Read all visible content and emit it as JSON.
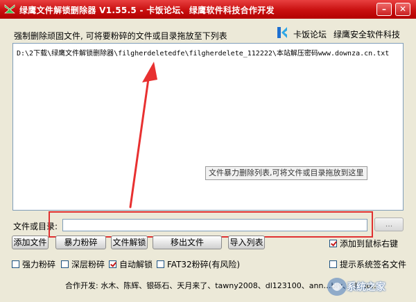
{
  "window": {
    "title": "绿鹰文件解锁删除器 V1.55.5 - 卡饭论坛、绿鹰软件科技合作开发",
    "minimize": "–",
    "close": "✕"
  },
  "header": {
    "description": "强制删除顽固文件, 可将要粉碎的文件或目录拖放至下列表",
    "brand1": "卡饭论坛",
    "brand2": "绿鹰安全软件科技"
  },
  "file_list": {
    "items": [
      "D:\\2下载\\绿鹰文件解锁删除器\\filgherdeletedfe\\filgherdelete_112222\\本站解压密码www.downza.cn.txt"
    ],
    "tooltip": "文件暴力删除列表,可将文件或目录拖放到这里"
  },
  "path": {
    "label": "文件或目录:",
    "value": "",
    "browse": "..."
  },
  "buttons": {
    "add_file": "添加文件",
    "force_shred": "暴力粉碎",
    "unlock": "文件解锁",
    "remove": "移出文件",
    "import_list": "导入列表"
  },
  "options": {
    "context_menu": {
      "label": "添加到鼠标右键",
      "checked": true
    },
    "strong_shred": {
      "label": "强力粉碎",
      "checked": false
    },
    "deep_shred": {
      "label": "深层粉碎",
      "checked": false
    },
    "auto_unlock": {
      "label": "自动解锁",
      "checked": true
    },
    "fat32_shred": {
      "label": "FAT32粉碎(有风险)",
      "checked": false
    },
    "sys_signature": {
      "label": "提示系统签名文件",
      "checked": false
    }
  },
  "credits": "合作开发: 水木、陈辉、银砾石、天月来了、tawny2008、dl123100、ann…bly、aJhao…",
  "watermark": "系统之家",
  "colors": {
    "titlebar": "#c80f0f",
    "highlight": "#e03030",
    "background": "#ece9d8"
  }
}
